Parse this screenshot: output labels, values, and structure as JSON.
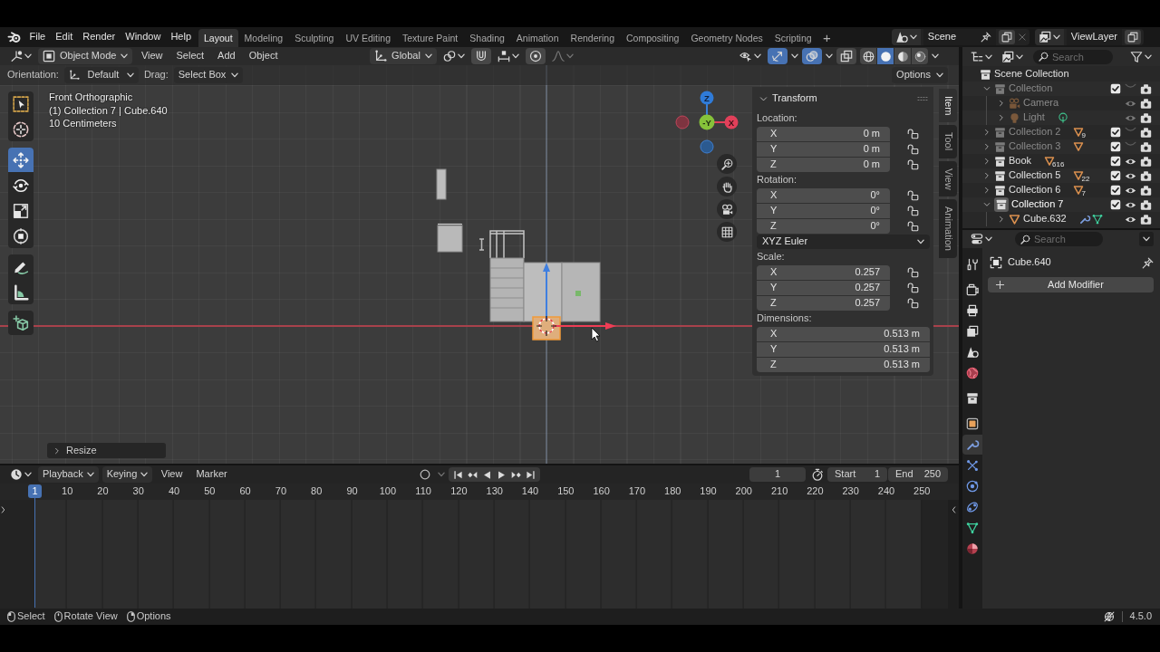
{
  "top_bar": {
    "menus": [
      "File",
      "Edit",
      "Render",
      "Window",
      "Help"
    ],
    "workspaces": [
      {
        "label": "Layout",
        "selected": true
      },
      {
        "label": "Modeling",
        "selected": false
      },
      {
        "label": "Sculpting",
        "selected": false
      },
      {
        "label": "UV Editing",
        "selected": false
      },
      {
        "label": "Texture Paint",
        "selected": false
      },
      {
        "label": "Shading",
        "selected": false
      },
      {
        "label": "Animation",
        "selected": false
      },
      {
        "label": "Rendering",
        "selected": false
      },
      {
        "label": "Compositing",
        "selected": false
      },
      {
        "label": "Geometry Nodes",
        "selected": false
      },
      {
        "label": "Scripting",
        "selected": false
      }
    ],
    "add_workspace": "+",
    "scene": "Scene",
    "view_layer": "ViewLayer"
  },
  "viewport": {
    "header": {
      "mode": "Object Mode",
      "menus": [
        "View",
        "Select",
        "Add",
        "Object"
      ],
      "orientation": "Global",
      "snap": {
        "on": false
      },
      "proportional_editing": {
        "on": false
      },
      "toggles": [
        {
          "kind": "gizmos",
          "on": true
        },
        {
          "kind": "overlays",
          "on": true
        },
        {
          "kind": "xray",
          "on": false
        }
      ],
      "shading": [
        {
          "kind": "wireframe",
          "selected": false
        },
        {
          "kind": "solid",
          "selected": true
        },
        {
          "kind": "material",
          "selected": false
        },
        {
          "kind": "rendered",
          "selected": false
        }
      ]
    },
    "tool_settings": {
      "orientation_label": "Orientation:",
      "orientation": "Default",
      "drag_label": "Drag:",
      "drag": "Select Box",
      "options": "Options"
    },
    "tool_groups": [
      {
        "tools": [
          {
            "kind": "select_box",
            "selected": false
          },
          {
            "kind": "cursor",
            "selected": false
          }
        ]
      },
      {
        "tools": [
          {
            "kind": "move",
            "selected": true
          },
          {
            "kind": "rotate",
            "selected": false
          },
          {
            "kind": "scale",
            "selected": false
          },
          {
            "kind": "transform",
            "selected": false
          }
        ]
      },
      {
        "tools": [
          {
            "kind": "annotate",
            "selected": false
          },
          {
            "kind": "measure",
            "selected": false
          }
        ]
      },
      {
        "tools": [
          {
            "kind": "add_cube",
            "selected": false
          }
        ]
      }
    ],
    "info": [
      "Front Orthographic",
      "(1) Collection 7 | Cube.640",
      "10 Centimeters"
    ],
    "gizmo": {
      "z": "Z",
      "y": "-Y",
      "x": "X"
    },
    "last_operator": "Resize",
    "sidebar": {
      "tabs": [
        {
          "label": "Item",
          "selected": true
        },
        {
          "label": "Tool",
          "selected": false
        },
        {
          "label": "View",
          "selected": false
        },
        {
          "label": "Animation",
          "selected": false
        }
      ],
      "panel": {
        "title": "Transform",
        "expanded": true,
        "groups": [
          {
            "kind": "vector",
            "label": "Location:",
            "lockable": true,
            "fields": [
              {
                "axis": "X",
                "value": "0 m"
              },
              {
                "axis": "Y",
                "value": "0 m"
              },
              {
                "axis": "Z",
                "value": "0 m"
              }
            ]
          },
          {
            "kind": "vector",
            "label": "Rotation:",
            "lockable": true,
            "fields": [
              {
                "axis": "X",
                "value": "0°"
              },
              {
                "axis": "Y",
                "value": "0°"
              },
              {
                "axis": "Z",
                "value": "0°"
              }
            ]
          },
          {
            "kind": "dropdown",
            "value": "XYZ Euler"
          },
          {
            "kind": "vector",
            "label": "Scale:",
            "lockable": true,
            "fields": [
              {
                "axis": "X",
                "value": "0.257"
              },
              {
                "axis": "Y",
                "value": "0.257"
              },
              {
                "axis": "Z",
                "value": "0.257"
              }
            ]
          },
          {
            "kind": "vector",
            "label": "Dimensions:",
            "lockable": false,
            "fields": [
              {
                "axis": "X",
                "value": "0.513 m"
              },
              {
                "axis": "Y",
                "value": "0.513 m"
              },
              {
                "axis": "Z",
                "value": "0.513 m"
              }
            ]
          }
        ]
      }
    }
  },
  "outliner": {
    "search": {
      "placeholder": "Search"
    },
    "tree": [
      {
        "name": "Scene Collection",
        "kind": "scene_collection",
        "children": [
          {
            "name": "Collection",
            "kind": "collection",
            "expanded": true,
            "checked": true,
            "visible": false,
            "dimmed": true,
            "active": false,
            "children": [
              {
                "name": "Camera",
                "kind": "camera",
                "expanded": false,
                "visible": true,
                "dimmed": true,
                "active": false
              },
              {
                "name": "Light",
                "kind": "light",
                "expanded": false,
                "visible": true,
                "dimmed": true,
                "active": false,
                "badges": [
                  {
                    "kind": "light_data"
                  }
                ]
              }
            ]
          },
          {
            "name": "Collection 2",
            "kind": "collection",
            "expanded": false,
            "checked": true,
            "visible": false,
            "dimmed": true,
            "active": false,
            "badges": [
              {
                "kind": "mesh",
                "count": "9"
              }
            ]
          },
          {
            "name": "Collection 3",
            "kind": "collection",
            "expanded": false,
            "checked": true,
            "visible": false,
            "dimmed": true,
            "active": false,
            "badges": [
              {
                "kind": "mesh"
              }
            ]
          },
          {
            "name": "Book",
            "kind": "collection",
            "expanded": false,
            "checked": true,
            "visible": true,
            "dimmed": false,
            "active": false,
            "badges": [
              {
                "kind": "mesh",
                "count": "616"
              }
            ]
          },
          {
            "name": "Collection 5",
            "kind": "collection",
            "expanded": false,
            "checked": true,
            "visible": true,
            "dimmed": false,
            "active": false,
            "badges": [
              {
                "kind": "mesh",
                "count": "22"
              }
            ]
          },
          {
            "name": "Collection 6",
            "kind": "collection",
            "expanded": false,
            "checked": true,
            "visible": true,
            "dimmed": false,
            "active": false,
            "badges": [
              {
                "kind": "mesh",
                "count": "7"
              }
            ]
          },
          {
            "name": "Collection 7",
            "kind": "collection",
            "expanded": true,
            "checked": true,
            "visible": true,
            "dimmed": false,
            "active": true,
            "children": [
              {
                "name": "Cube.632",
                "kind": "mesh",
                "expanded": false,
                "visible": true,
                "dimmed": false,
                "active": false,
                "badges": [
                  {
                    "kind": "modifier"
                  },
                  {
                    "kind": "mesh_data"
                  }
                ]
              }
            ]
          }
        ]
      }
    ]
  },
  "properties": {
    "search": {
      "placeholder": "Search"
    },
    "tab_groups": [
      {
        "tabs": [
          {
            "kind": "tool",
            "selected": false
          }
        ]
      },
      {
        "tabs": [
          {
            "kind": "render",
            "selected": false
          },
          {
            "kind": "output",
            "selected": false
          },
          {
            "kind": "view_layer",
            "selected": false
          },
          {
            "kind": "scene",
            "selected": false
          },
          {
            "kind": "world",
            "selected": false
          }
        ]
      },
      {
        "tabs": [
          {
            "kind": "collection",
            "selected": false
          }
        ]
      },
      {
        "tabs": [
          {
            "kind": "object",
            "selected": false
          },
          {
            "kind": "modifiers",
            "selected": true
          },
          {
            "kind": "particles",
            "selected": false
          },
          {
            "kind": "physics",
            "selected": false
          },
          {
            "kind": "constraints",
            "selected": false
          },
          {
            "kind": "data",
            "selected": false
          },
          {
            "kind": "material",
            "selected": false
          }
        ]
      }
    ],
    "object": "Cube.640",
    "add_button": "Add Modifier"
  },
  "timeline": {
    "menus": [
      {
        "label": "Playback",
        "dropdown": true
      },
      {
        "label": "Keying",
        "dropdown": true
      },
      {
        "label": "View",
        "dropdown": false
      },
      {
        "label": "Marker",
        "dropdown": false
      }
    ],
    "auto_keying": false,
    "controls": [
      {
        "kind": "jump_start"
      },
      {
        "kind": "prev_key"
      },
      {
        "kind": "play_reverse"
      },
      {
        "kind": "play"
      },
      {
        "kind": "next_key"
      },
      {
        "kind": "jump_end"
      }
    ],
    "current_frame": "1",
    "start_label": "Start",
    "start": "1",
    "end_label": "End",
    "end": "250",
    "playhead": "1",
    "ruler": [
      "10",
      "20",
      "30",
      "40",
      "50",
      "60",
      "70",
      "80",
      "90",
      "100",
      "110",
      "120",
      "130",
      "140",
      "150",
      "160",
      "170",
      "180",
      "190",
      "200",
      "210",
      "220",
      "230",
      "240",
      "250"
    ]
  },
  "status_bar": {
    "hints": [
      {
        "kind": "left_click",
        "label": "Select"
      },
      {
        "kind": "middle_click",
        "label": "Rotate View"
      },
      {
        "kind": "right_click",
        "label": "Options"
      }
    ],
    "version": "4.5.0"
  }
}
